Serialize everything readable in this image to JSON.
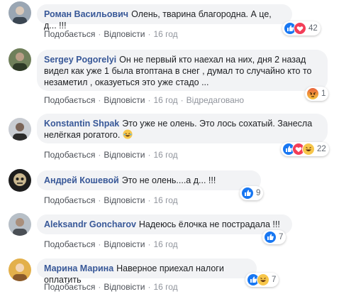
{
  "actions": {
    "like": "Подобається",
    "reply": "Відповісти",
    "edited": "Відредаговано"
  },
  "comments": [
    {
      "author": "Роман Васильович",
      "text": "Олень, тварина благородна. А це, д... !!!",
      "time": "16 год",
      "reactions": [
        "like",
        "love"
      ],
      "count": "42"
    },
    {
      "author": "Sergey Pogorelyi",
      "text": "Он не первый кто наехал на них, дня 2 назад видел как уже 1 была втоптана в снег , думал то случайно кто то незаметил , оказуеться это уже стадо ...",
      "time": "16 год",
      "reactions": [
        "angry"
      ],
      "count": "1"
    },
    {
      "author": "Konstantin Shpak",
      "text": "Это уже не олень. Это лось сохатый. Занесла нелёгкая рогатого.",
      "time": "16 год",
      "reactions": [
        "like",
        "love",
        "haha"
      ],
      "count": "22"
    },
    {
      "author": "Андрей Кошевой",
      "text": "Это не олень....а д... !!!",
      "time": "16 год",
      "reactions": [
        "like"
      ],
      "count": "9"
    },
    {
      "author": "Aleksandr Goncharov",
      "text": "Надеюсь ёлочка не пострадала !!!",
      "time": "16 год",
      "reactions": [
        "like"
      ],
      "count": "7"
    },
    {
      "author": "Марина Марина",
      "text": "Наверное приехал налоги оплатить",
      "time": "16 год",
      "reactions": [
        "like",
        "haha"
      ],
      "count": "7"
    }
  ]
}
